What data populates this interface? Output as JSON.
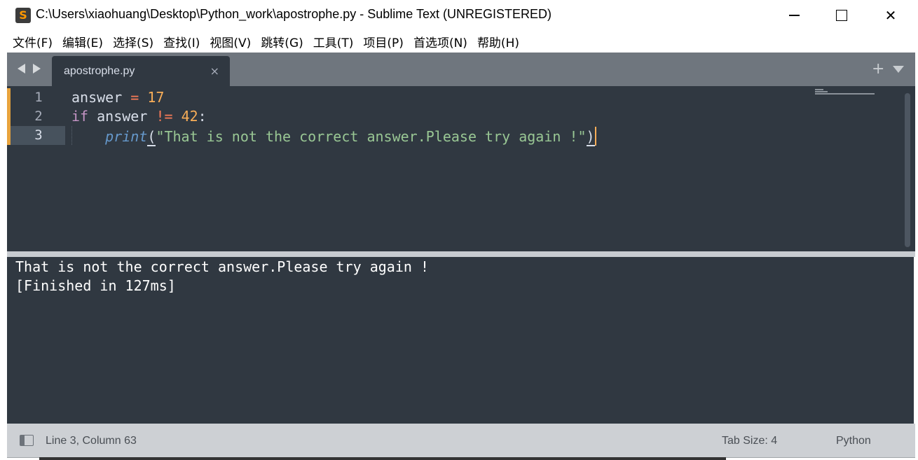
{
  "window": {
    "title": "C:\\Users\\xiaohuang\\Desktop\\Python_work\\apostrophe.py - Sublime Text (UNREGISTERED)",
    "app_icon_glyph": "S",
    "minimize_icon": "minimize-icon",
    "maximize_icon": "maximize-icon",
    "close_glyph": "✕"
  },
  "menu": {
    "items": [
      "文件(F)",
      "编辑(E)",
      "选择(S)",
      "查找(I)",
      "视图(V)",
      "跳转(G)",
      "工具(T)",
      "项目(P)",
      "首选项(N)",
      "帮助(H)"
    ]
  },
  "tabs": {
    "active": {
      "label": "apostrophe.py",
      "close_glyph": "×"
    },
    "new_tab_glyph": "+"
  },
  "editor": {
    "line_numbers": [
      "1",
      "2",
      "3"
    ],
    "current_line": 3,
    "code": {
      "line1": {
        "var": "answer",
        "op": "=",
        "num": "17"
      },
      "line2": {
        "kw": "if",
        "var": "answer",
        "op": "!=",
        "num": "42",
        "colon": ":"
      },
      "line3": {
        "fn": "print",
        "open": "(",
        "str": "\"That is not the correct answer.Please try again !\"",
        "close": ")"
      }
    },
    "syntax_colors": {
      "background": "#303841",
      "operator": "#f97b58",
      "number": "#f9ae58",
      "keyword": "#c695c6",
      "function": "#6699cc",
      "string": "#99c794"
    }
  },
  "output": {
    "lines": [
      "That is not the correct answer.Please try again !",
      "[Finished in 127ms]"
    ]
  },
  "status": {
    "position": "Line 3, Column 63",
    "tab_size": "Tab Size: 4",
    "syntax": "Python"
  }
}
